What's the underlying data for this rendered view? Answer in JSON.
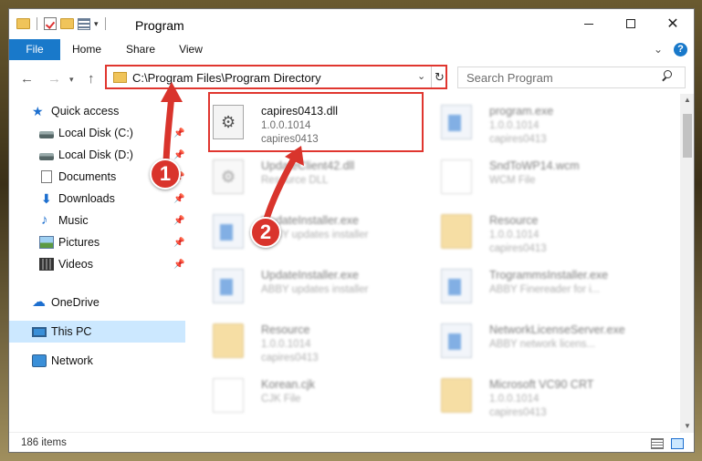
{
  "window": {
    "title": "Program"
  },
  "ribbon": {
    "tabs": [
      "File",
      "Home",
      "Share",
      "View"
    ],
    "help": "?"
  },
  "address": {
    "path": "C:\\Program Files\\Program Directory",
    "dropdown": "⌄",
    "refresh": "↻"
  },
  "search": {
    "placeholder": "Search Program"
  },
  "sidebar": {
    "items": [
      {
        "label": "Quick access",
        "icon": "star-icon"
      },
      {
        "label": "Local Disk (C:)",
        "icon": "drive-icon",
        "pinned": true
      },
      {
        "label": "Local Disk (D:)",
        "icon": "drive-icon",
        "pinned": true
      },
      {
        "label": "Documents",
        "icon": "documents-icon",
        "pinned": true
      },
      {
        "label": "Downloads",
        "icon": "download-icon",
        "pinned": true
      },
      {
        "label": "Music",
        "icon": "music-icon",
        "pinned": true
      },
      {
        "label": "Pictures",
        "icon": "pictures-icon",
        "pinned": true
      },
      {
        "label": "Videos",
        "icon": "videos-icon",
        "pinned": true
      },
      {
        "label": "OneDrive",
        "icon": "cloud-icon"
      },
      {
        "label": "This PC",
        "icon": "computer-icon",
        "selected": true
      },
      {
        "label": "Network",
        "icon": "network-icon"
      }
    ]
  },
  "files": [
    {
      "name": "capires0413.dll",
      "line1": "1.0.0.1014",
      "line2": "capires0413",
      "type": "dll",
      "highlighted": true
    },
    {
      "name": "program.exe",
      "line1": "1.0.0.1014",
      "line2": "capires0413",
      "type": "exe"
    },
    {
      "name": "UpdateClient42.dll",
      "line1": "Resource DLL",
      "line2": "",
      "type": "dll"
    },
    {
      "name": "SndToWP14.wcm",
      "line1": "WCM File",
      "line2": "",
      "type": "doc"
    },
    {
      "name": "UpdateInstaller.exe",
      "line1": "ABBY updates installer",
      "line2": "",
      "type": "exe"
    },
    {
      "name": "Resource",
      "line1": "1.0.0.1014",
      "line2": "capires0413",
      "type": "folder"
    },
    {
      "name": "UpdateInstaller.exe",
      "line1": "ABBY updates installer",
      "line2": "",
      "type": "exe"
    },
    {
      "name": "TrogrammsInstaller.exe",
      "line1": "ABBY Finereader for i...",
      "line2": "",
      "type": "exe"
    },
    {
      "name": "Resource",
      "line1": "1.0.0.1014",
      "line2": "capires0413",
      "type": "folder"
    },
    {
      "name": "NetworkLicenseServer.exe",
      "line1": "ABBY network licens...",
      "line2": "",
      "type": "exe"
    },
    {
      "name": "Korean.cjk",
      "line1": "CJK File",
      "line2": "",
      "type": "doc"
    },
    {
      "name": "Microsoft VC90 CRT",
      "line1": "1.0.0.1014",
      "line2": "capires0413",
      "type": "folder"
    }
  ],
  "status": {
    "item_count": "186 items"
  },
  "annotations": {
    "callout1": "1",
    "callout2": "2",
    "color": "#d9342c"
  },
  "colors": {
    "accent": "#1979ca",
    "selection": "#cce8ff",
    "highlight": "#e0362f"
  }
}
